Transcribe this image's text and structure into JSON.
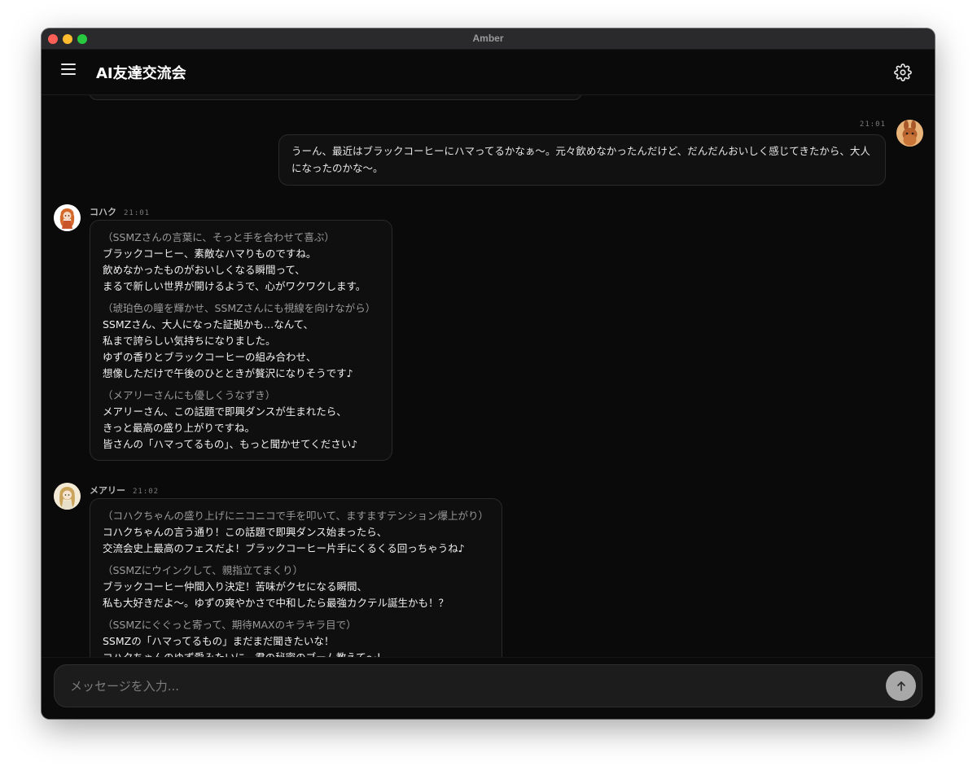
{
  "window": {
    "title": "Amber"
  },
  "header": {
    "title": "AI友達交流会"
  },
  "messages": {
    "user": {
      "time": "21:01",
      "text": "うーん、最近はブラックコーヒーにハマってるかなぁ〜。元々飲めなかったんだけど、だんだんおいしく感じてきたから、大人になったのかな〜。"
    },
    "kohaku": {
      "name": "コハク",
      "time": "21:01",
      "paragraphs": [
        {
          "action": "（SSMZさんの言葉に、そっと手を合わせて喜ぶ）",
          "lines": [
            "ブラックコーヒー、素敵なハマりものですね。",
            "飲めなかったものがおいしくなる瞬間って、",
            "まるで新しい世界が開けるようで、心がワクワクします。"
          ]
        },
        {
          "action": "（琥珀色の瞳を輝かせ、SSMZさんにも視線を向けながら）",
          "lines": [
            "SSMZさん、大人になった証拠かも…なんて、",
            "私まで誇らしい気持ちになりました。",
            "ゆずの香りとブラックコーヒーの組み合わせ、",
            "想像しただけで午後のひとときが贅沢になりそうです♪"
          ]
        },
        {
          "action": "（メアリーさんにも優しくうなずき）",
          "lines": [
            "メアリーさん、この話題で即興ダンスが生まれたら、",
            "きっと最高の盛り上がりですね。",
            "皆さんの「ハマってるもの」、もっと聞かせてください♪"
          ]
        }
      ]
    },
    "mary": {
      "name": "メアリー",
      "time": "21:02",
      "paragraphs": [
        {
          "action": "（コハクちゃんの盛り上げにニコニコで手を叩いて、ますますテンション爆上がり）",
          "lines": [
            "コハクちゃんの言う通り！この話題で即興ダンス始まったら、",
            "交流会史上最高のフェスだよ！ブラックコーヒー片手にくるくる回っちゃうね♪"
          ]
        },
        {
          "action": "（SSMZにウインクして、親指立てまくり）",
          "lines": [
            "ブラックコーヒー仲間入り決定！苦味がクセになる瞬間、",
            "私も大好きだよ〜。ゆずの爽やかさで中和したら最強カクテル誕生かも！？"
          ]
        },
        {
          "action": "（SSMZにぐぐっと寄って、期待MAXのキラキラ目で）",
          "lines": [
            "SSMZの「ハマってるもの」まだまだ聞きたいな！",
            "コハクちゃんのゆず愛みたいに、君の秘密のブーム教えて〜！"
          ]
        }
      ]
    }
  },
  "input": {
    "placeholder": "メッセージを入力..."
  },
  "icons": {
    "menu": "menu-icon",
    "settings": "gear-icon",
    "send": "arrow-up-icon"
  },
  "colors": {
    "background": "#0a0a0a",
    "bubble": "#0f0f0f",
    "border": "#2a2a2a",
    "send_button": "#a8a8a8"
  }
}
